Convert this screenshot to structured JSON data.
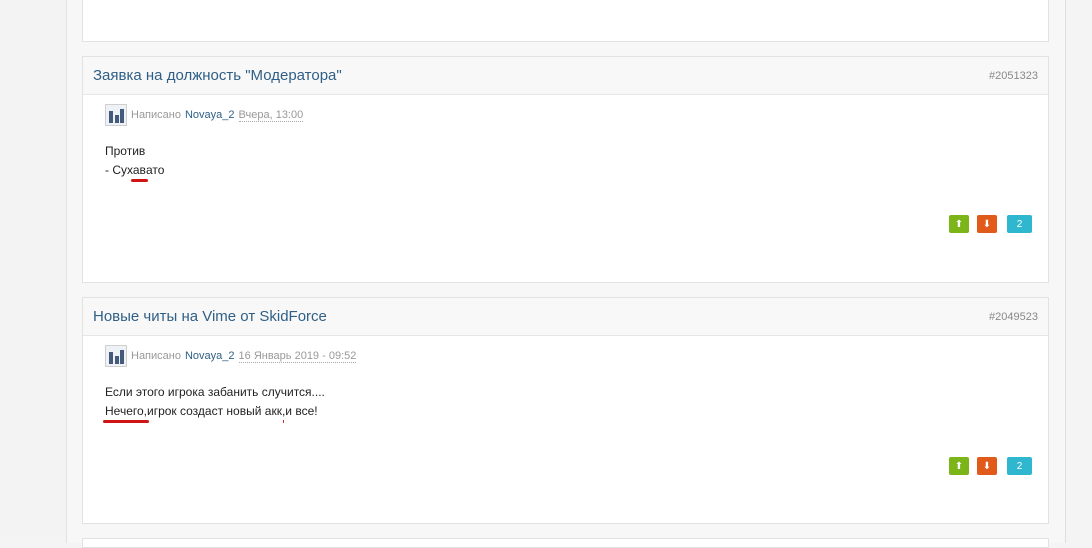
{
  "posts": [
    {
      "title": "Заявка на должность \"Модератора\"",
      "id": "#2051323",
      "written_label": "Написано",
      "author": "Novaya_2",
      "date": "Вчера, 13:00",
      "lines": [
        {
          "segments": [
            "Против"
          ]
        },
        {
          "segments": [
            "- Сух",
            "ав",
            "ато"
          ]
        }
      ],
      "vote_up_icon": "arrow-up-icon",
      "vote_down_icon": "arrow-down-icon",
      "vote_up_glyph": "⬆",
      "vote_down_glyph": "⬇",
      "vote_count": "2"
    },
    {
      "title": "Новые читы на Vime от SkidForce",
      "id": "#2049523",
      "written_label": "Написано",
      "author": "Novaya_2",
      "date": "16 Январь 2019 - 09:52",
      "lines": [
        {
          "segments": [
            "Если этого игрока забанить случится...."
          ]
        },
        {
          "segments": [
            "Нечего,",
            "игрок создаст новый акк",
            ",",
            "и все!"
          ]
        }
      ],
      "vote_up_icon": "arrow-up-icon",
      "vote_down_icon": "arrow-down-icon",
      "vote_up_glyph": "⬆",
      "vote_down_glyph": "⬇",
      "vote_count": "2"
    }
  ],
  "colors": {
    "link": "#2f5f86",
    "vote_up": "#7cb518",
    "vote_down": "#e15a1a",
    "vote_count": "#2fb7cf",
    "underline_markup": "#d01414"
  }
}
